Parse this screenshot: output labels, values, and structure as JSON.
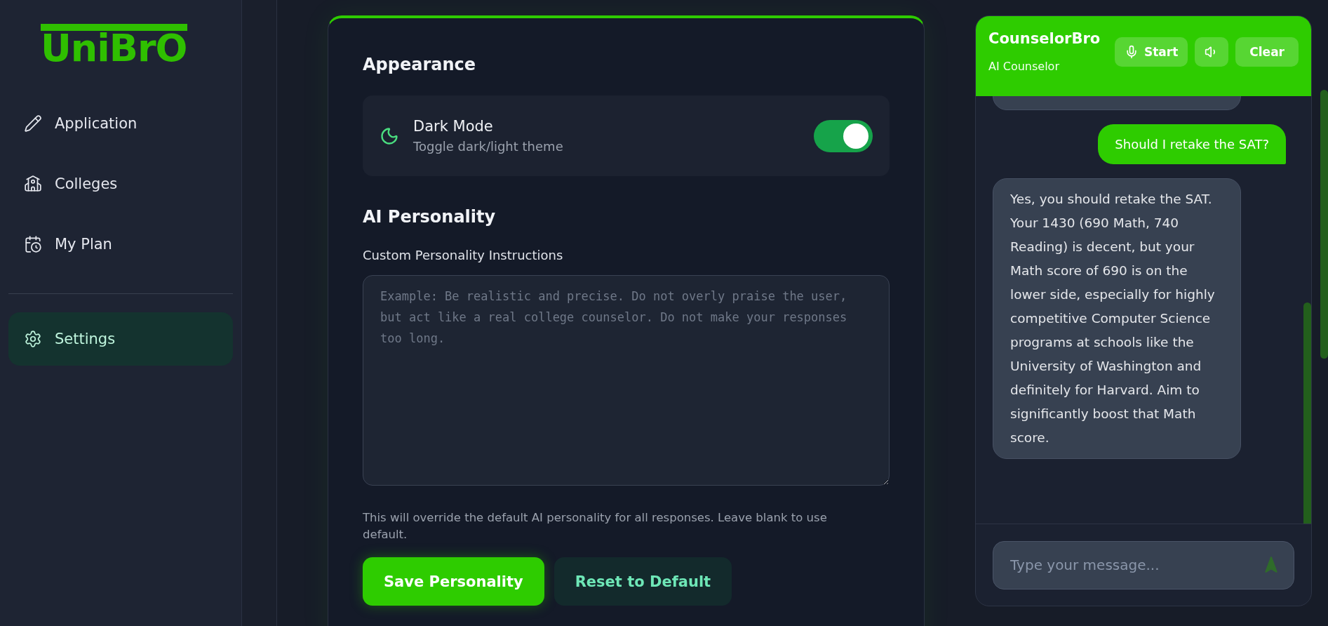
{
  "logo": "UniBrO",
  "sidebar": {
    "items": [
      {
        "label": "Application",
        "kind": "pencil",
        "selected": false
      },
      {
        "label": "Colleges",
        "kind": "school",
        "selected": false
      },
      {
        "label": "My Plan",
        "kind": "calendar",
        "selected": false
      },
      {
        "label": "Settings",
        "kind": "gear",
        "selected": true
      }
    ]
  },
  "settings": {
    "appearance": {
      "heading": "Appearance",
      "dark_mode": {
        "title": "Dark Mode",
        "subtitle": "Toggle dark/light theme",
        "on": true
      }
    },
    "personality": {
      "heading": "AI Personality",
      "label": "Custom Personality Instructions",
      "placeholder": "Example: Be realistic and precise. Do not overly praise the user, but act like a real college counselor. Do not make your responses too long.",
      "help": "This will override the default AI personality for all responses. Leave blank to use default.",
      "buttons": [
        {
          "label": "Save Personality",
          "kind": "primary"
        },
        {
          "label": "Reset to Default",
          "kind": "secondary"
        }
      ]
    }
  },
  "chat": {
    "title": "CounselorBro",
    "subtitle": "AI Counselor",
    "start_label": "Start",
    "clear_label": "Clear",
    "messages": [
      {
        "kind": "partial"
      },
      {
        "kind": "user",
        "text": "Should I retake the SAT?"
      },
      {
        "kind": "bot",
        "text": "Yes, you should retake the SAT. Your 1430 (690 Math, 740 Reading) is decent, but your Math score of 690 is on the lower side, especially for highly competitive Computer Science programs at schools like the University of Washington and definitely for Harvard. Aim to significantly boost that Math score."
      }
    ],
    "input": {
      "placeholder": "Type your message..."
    }
  }
}
